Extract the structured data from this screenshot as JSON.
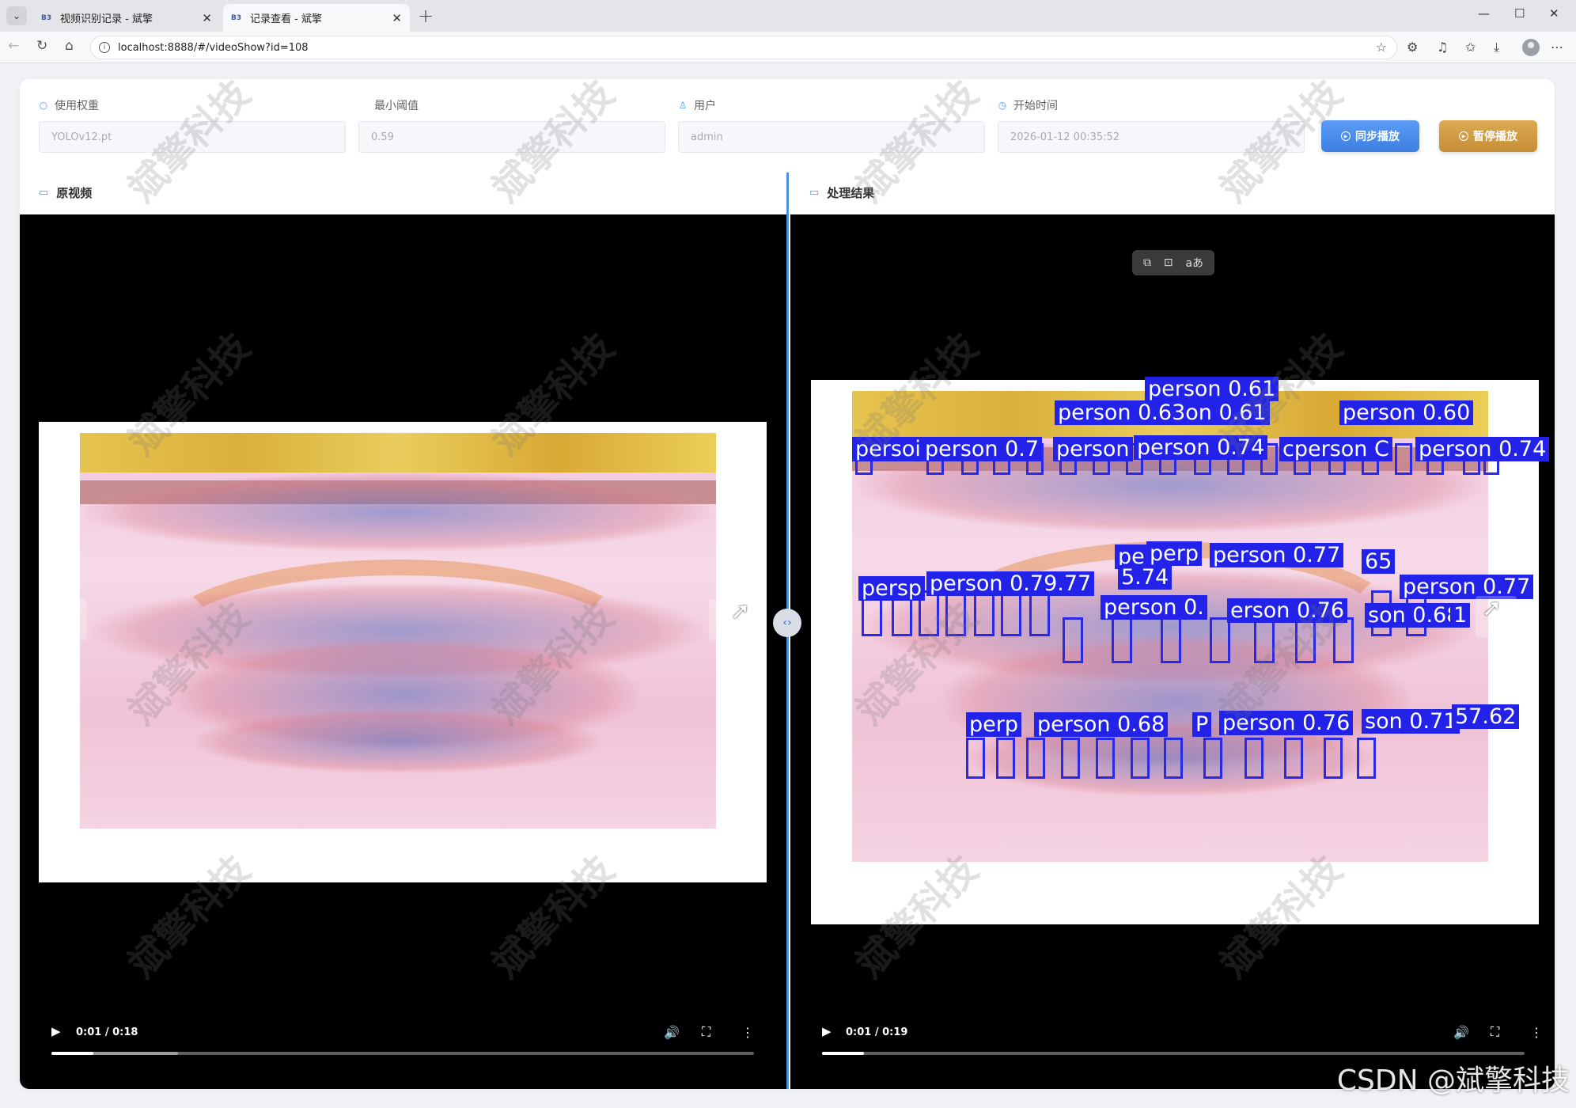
{
  "browser": {
    "tabs": [
      {
        "favicon": "B3",
        "title": "视频识别记录 - 斌擎",
        "close": "✕"
      },
      {
        "favicon": "B3",
        "title": "记录查看 - 斌擎",
        "close": "✕"
      }
    ],
    "new_tab": "+",
    "url": "localhost:8888/#/videoShow?id=108",
    "window": {
      "minimize": "—",
      "maximize": "☐",
      "close": "✕"
    }
  },
  "filters": {
    "weight": {
      "label": "使用权重",
      "value": "YOLOv12.pt"
    },
    "threshold": {
      "label": "最小阈值",
      "value": "0.59"
    },
    "user": {
      "label": "用户",
      "value": "admin"
    },
    "start_time": {
      "label": "开始时间",
      "value": "2026-01-12 00:35:52"
    }
  },
  "buttons": {
    "sync_play": "同步播放",
    "pause_play": "暂停播放"
  },
  "panels": {
    "original": {
      "title": "原视频",
      "time": "0:01 / 0:18",
      "progress": 0.06,
      "buffered": 0.18
    },
    "result": {
      "title": "处理结果",
      "time": "0:01 / 0:19",
      "progress": 0.06,
      "buffered": 0.06
    }
  },
  "detections": [
    "person 0.61",
    "person 0.63on 0.61",
    "person 0.60",
    "persoi",
    "person 0.7",
    "person",
    "person 0.74",
    "cperson C",
    "person 0.74",
    "pe",
    "perp",
    "person 0.77",
    "65",
    "person 0.77",
    "persp",
    "person 0.79.77",
    "5.74",
    "person 0.",
    "erson 0.76",
    "son 0.68",
    "1",
    "perp",
    "person 0.68",
    "P",
    "person 0.76",
    "son 0.71",
    "57.62"
  ],
  "watermark": "斌擎科技",
  "credit": "CSDN @斌擎科技",
  "colors": {
    "accent": "#409eff",
    "divider": "#4a90e2",
    "sync_button": "#3e7fe0",
    "pause_button": "#c58d35",
    "box": "#2222e8"
  }
}
